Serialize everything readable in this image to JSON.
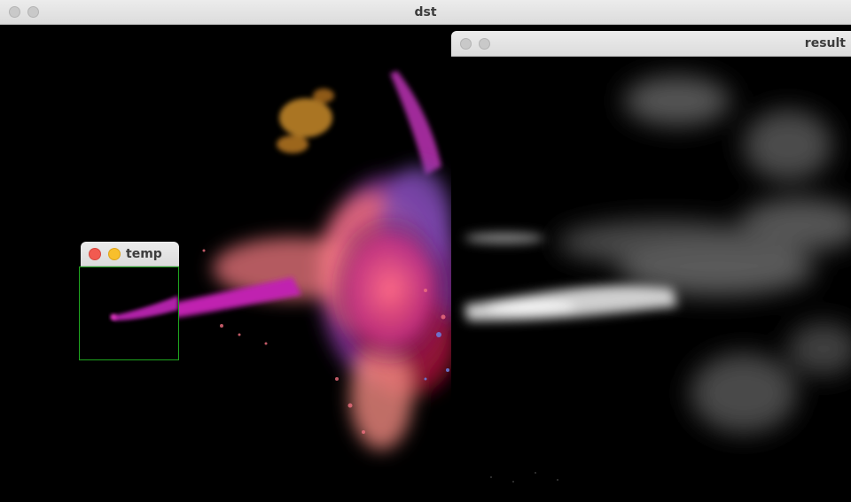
{
  "windows": {
    "dst": {
      "title": "dst"
    },
    "result": {
      "title": "result"
    },
    "temp": {
      "title": "temp"
    }
  },
  "colors": {
    "titlebar": "#e2e2e2",
    "close": "#f25a50",
    "minimize": "#f8bf2c",
    "match_rect": "#1fa61f"
  }
}
